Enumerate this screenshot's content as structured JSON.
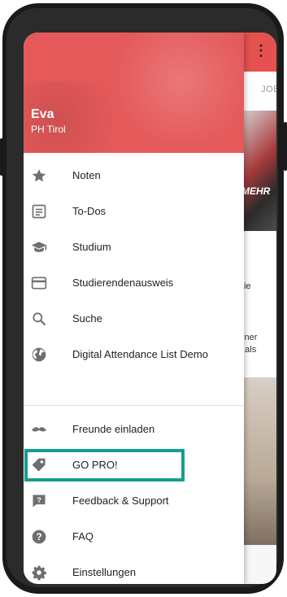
{
  "profile": {
    "name": "Eva",
    "school": "PH Tirol"
  },
  "menu_primary": [
    {
      "label": "Noten",
      "icon": "star-icon"
    },
    {
      "label": "To-Dos",
      "icon": "note-list-icon"
    },
    {
      "label": "Studium",
      "icon": "graduation-cap-icon"
    },
    {
      "label": "Studierendenausweis",
      "icon": "credit-card-icon"
    },
    {
      "label": "Suche",
      "icon": "search-icon"
    },
    {
      "label": "Digital Attendance List Demo",
      "icon": "globe-icon"
    }
  ],
  "menu_secondary": [
    {
      "label": "Freunde einladen",
      "icon": "mustache-icon"
    },
    {
      "label": "GO PRO!",
      "icon": "tag-icon"
    },
    {
      "label": "Feedback & Support",
      "icon": "feedback-icon"
    },
    {
      "label": "FAQ",
      "icon": "help-circle-icon"
    },
    {
      "label": "Einstellungen",
      "icon": "gear-icon"
    }
  ],
  "background": {
    "tab_label": "JOB",
    "image_caption": "MEHR",
    "card_text_1": "die",
    "card_text_2a": "iener",
    "card_text_2b": "g als"
  },
  "colors": {
    "header": "#e5595a",
    "highlight": "#159d93",
    "icon": "#6f6f6f"
  }
}
